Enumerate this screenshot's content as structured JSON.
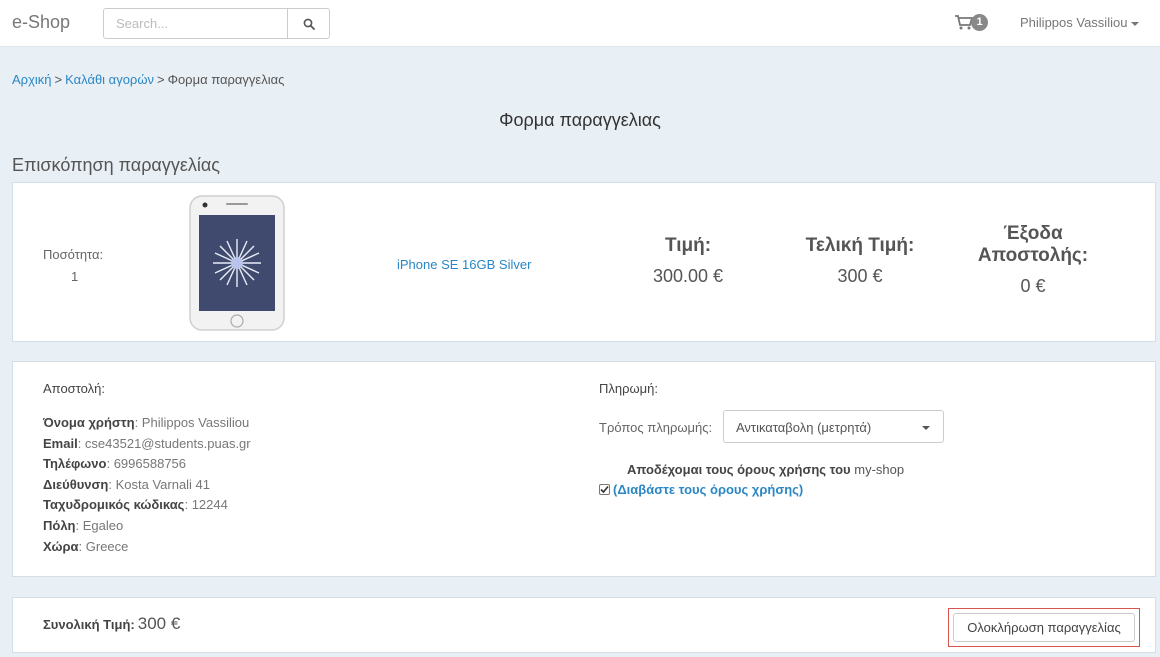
{
  "navbar": {
    "brand": "e-Shop",
    "search_placeholder": "Search...",
    "cart_count": "1",
    "user_name": "Philippos Vassiliou"
  },
  "breadcrumb": {
    "home": "Αρχική",
    "cart": "Καλάθι αγορών",
    "current": "Φορμα παραγγελιας",
    "separator": ">"
  },
  "page_title": "Φορμα παραγγελιας",
  "overview": {
    "title": "Επισκόπηση παραγγελίας",
    "quantity_label": "Ποσότητα:",
    "quantity_value": "1",
    "product_name": "iPhone SE 16GB Silver",
    "price_label": "Τιμή:",
    "price_value": "300.00 €",
    "final_price_label": "Τελική Τιμή:",
    "final_price_value": "300 €",
    "shipping_label_line1": "Έξοδα",
    "shipping_label_line2": "Αποστολής:",
    "shipping_value": "0 €"
  },
  "shipping": {
    "heading": "Αποστολή:",
    "fields": [
      {
        "label": "Όνομα χρήστη",
        "value": "Philippos Vassiliou"
      },
      {
        "label": "Email",
        "value": "cse43521@students.puas.gr"
      },
      {
        "label": "Τηλέφωνο",
        "value": "6996588756"
      },
      {
        "label": "Διεύθυνση",
        "value": "Kosta Varnali 41"
      },
      {
        "label": "Ταχυδρομικός κώδικας",
        "value": "12244"
      },
      {
        "label": "Πόλη",
        "value": "Egaleo"
      },
      {
        "label": "Χώρα",
        "value": "Greece"
      }
    ]
  },
  "payment": {
    "heading": "Πληρωμή:",
    "method_label": "Τρόπος πληρωμής:",
    "method_selected": "Αντικαταβολη (μετρητά)",
    "terms_text": "Αποδέχομαι τους όρους χρήσης του",
    "terms_brand": "my-shop",
    "terms_link": "(Διαβάστε τους όρους χρήσης)",
    "terms_checked": true
  },
  "total": {
    "label": "Συνολική Τιμή:",
    "value": "300 €",
    "complete_button": "Ολοκλήρωση παραγγελίας"
  },
  "colors": {
    "accent_link": "#2a87c5",
    "background": "#e8eff5",
    "highlight_border": "#d9534f"
  }
}
